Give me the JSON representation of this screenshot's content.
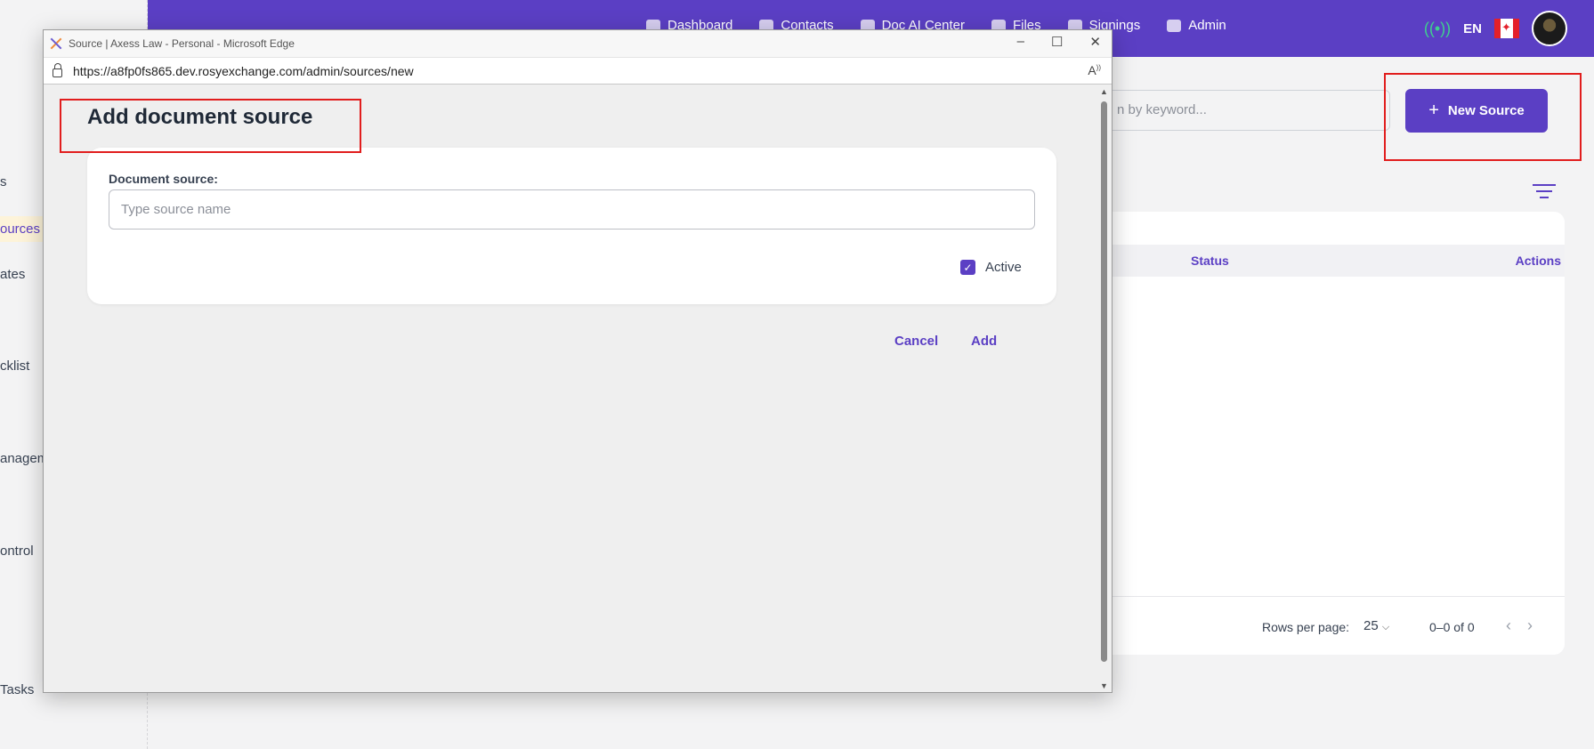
{
  "background": {
    "nav": [
      "Dashboard",
      "Contacts",
      "Doc AI Center",
      "Files",
      "Signings",
      "Admin"
    ],
    "language": "EN",
    "sidebar": [
      "s",
      "ources",
      "ates",
      "cklist",
      "anagem",
      "ontrol",
      "Tasks"
    ],
    "search_placeholder": "n by keyword...",
    "new_source_label": "New Source",
    "table": {
      "status_header": "Status",
      "actions_header": "Actions"
    },
    "footer": {
      "rows_per_page_label": "Rows per page:",
      "rows_per_page_value": "25",
      "range": "0–0 of 0"
    }
  },
  "popup": {
    "window_title": "Source | Axess Law - Personal - Microsoft Edge",
    "url": "https://a8fp0fs865.dev.rosyexchange.com/admin/sources/new",
    "page_title": "Add document source",
    "field_label": "Document source:",
    "field_placeholder": "Type source name",
    "field_value": "",
    "active_label": "Active",
    "active_checked": true,
    "cancel_label": "Cancel",
    "add_label": "Add"
  },
  "colors": {
    "brand": "#5b3fc4",
    "highlight_box": "#e11d1d"
  }
}
